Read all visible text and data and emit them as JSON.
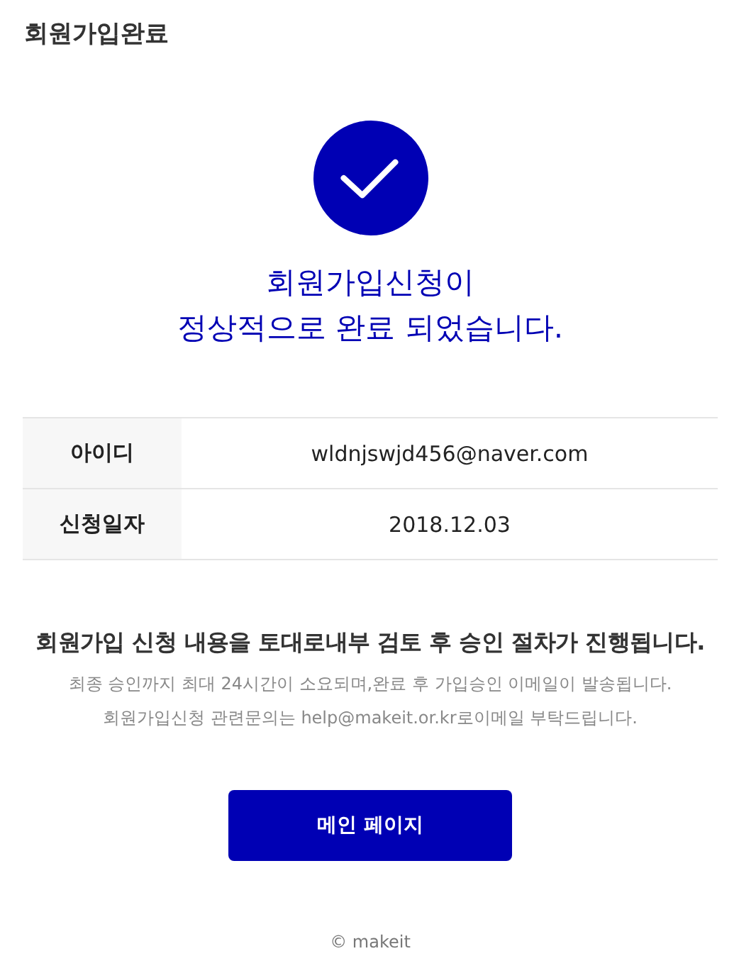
{
  "page_title": "회원가입완료",
  "headline": [
    "회원가입신청이",
    "정상적으로 완료 되었습니다."
  ],
  "info_rows": [
    {
      "label": "아이디",
      "value": "wldnjswjd456@naver.com"
    },
    {
      "label": "신청일자",
      "value": "2018.12.03"
    }
  ],
  "notice": {
    "title": "회원가입 신청 내용을 토대로내부 검토 후 승인 절차가 진행됩니다.",
    "lines": [
      "최종 승인까지 최대 24시간이 소요되며,완료 후 가입승인 이메일이 발송됩니다.",
      "회원가입신청 관련문의는 help@makeit.or.kr로이메일 부탁드립니다."
    ]
  },
  "button": "메인 페이지",
  "footer": "© makeit"
}
